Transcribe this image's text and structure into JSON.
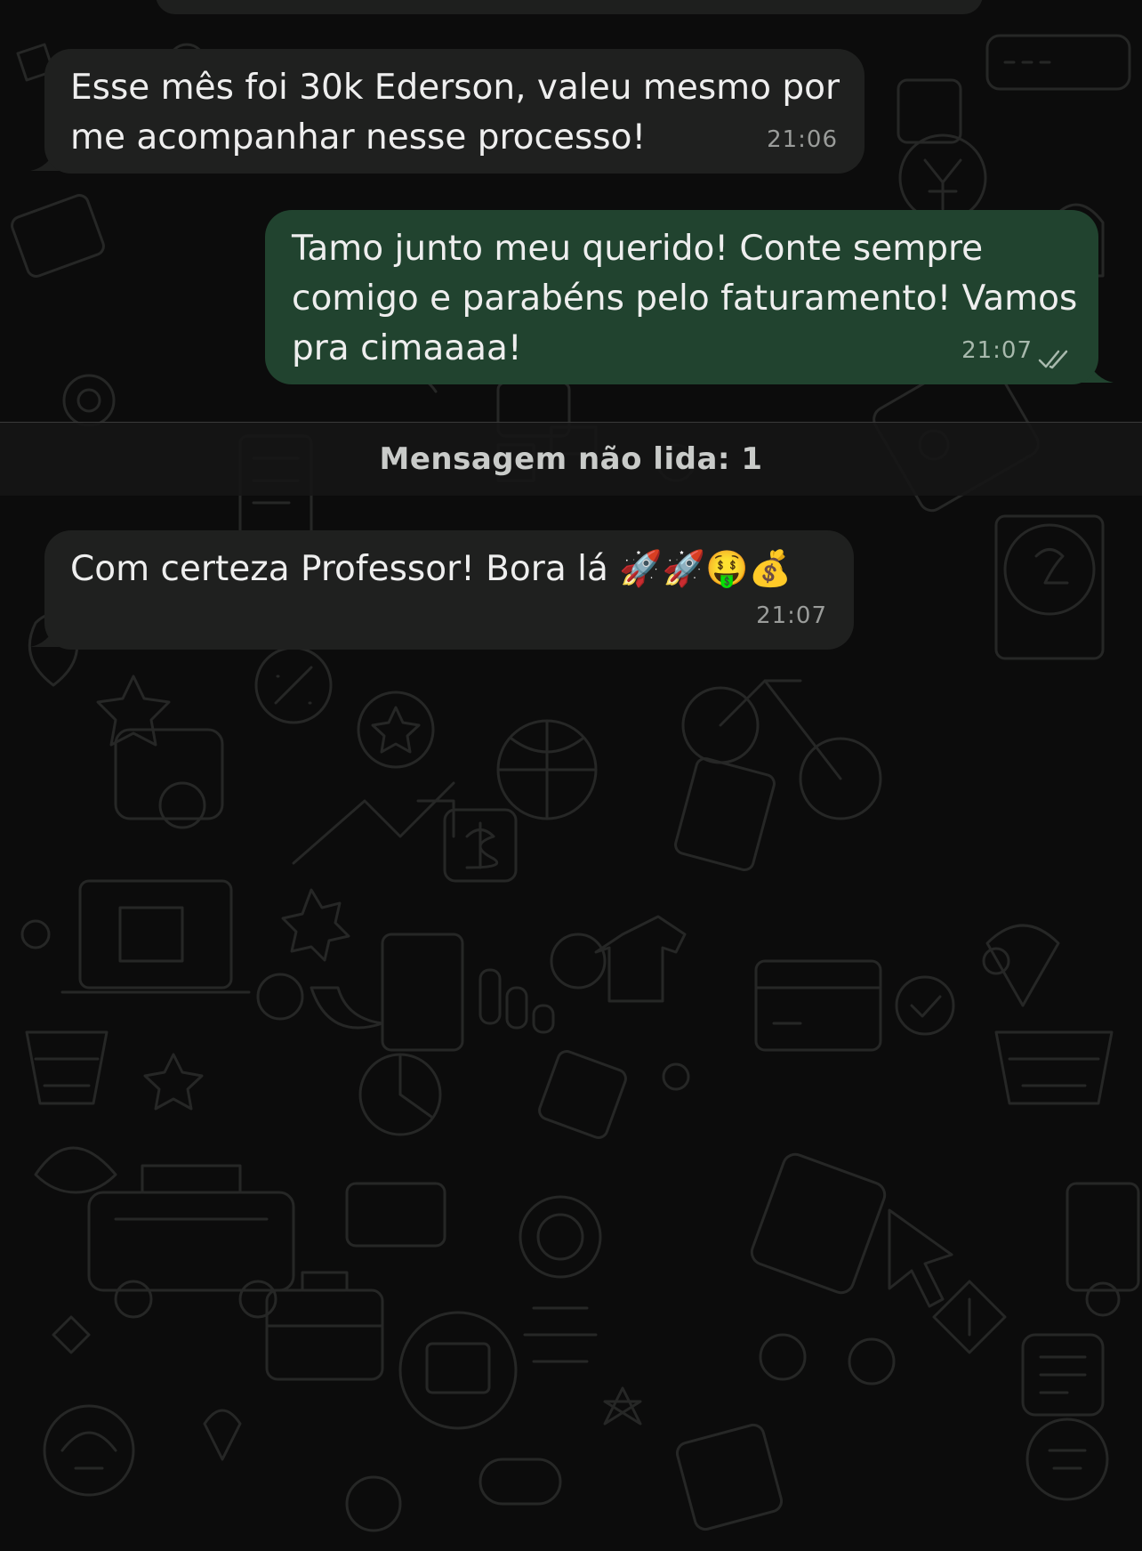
{
  "chat": {
    "messages": [
      {
        "direction": "incoming",
        "lines": [
          "Esse mês foi 30k Ederson, valeu mesmo por",
          "me acompanhar nesse processo!"
        ],
        "time": "21:06"
      },
      {
        "direction": "outgoing",
        "lines": [
          "Tamo junto meu querido! Conte sempre",
          "comigo e parabéns pelo faturamento! Vamos",
          "pra cimaaaa!"
        ],
        "time": "21:07",
        "status_icon": "double-check-icon"
      },
      {
        "direction": "incoming",
        "lines": [
          "Com certeza Professor! Bora lá 🚀🚀🤑💰"
        ],
        "time": "21:07"
      }
    ],
    "unread_divider": "Mensagem não lida: 1"
  },
  "colors": {
    "background": "#0c0c0c",
    "incoming_bubble": "#1f201f",
    "outgoing_bubble": "#21432f",
    "doodle_stroke": "#262726"
  }
}
